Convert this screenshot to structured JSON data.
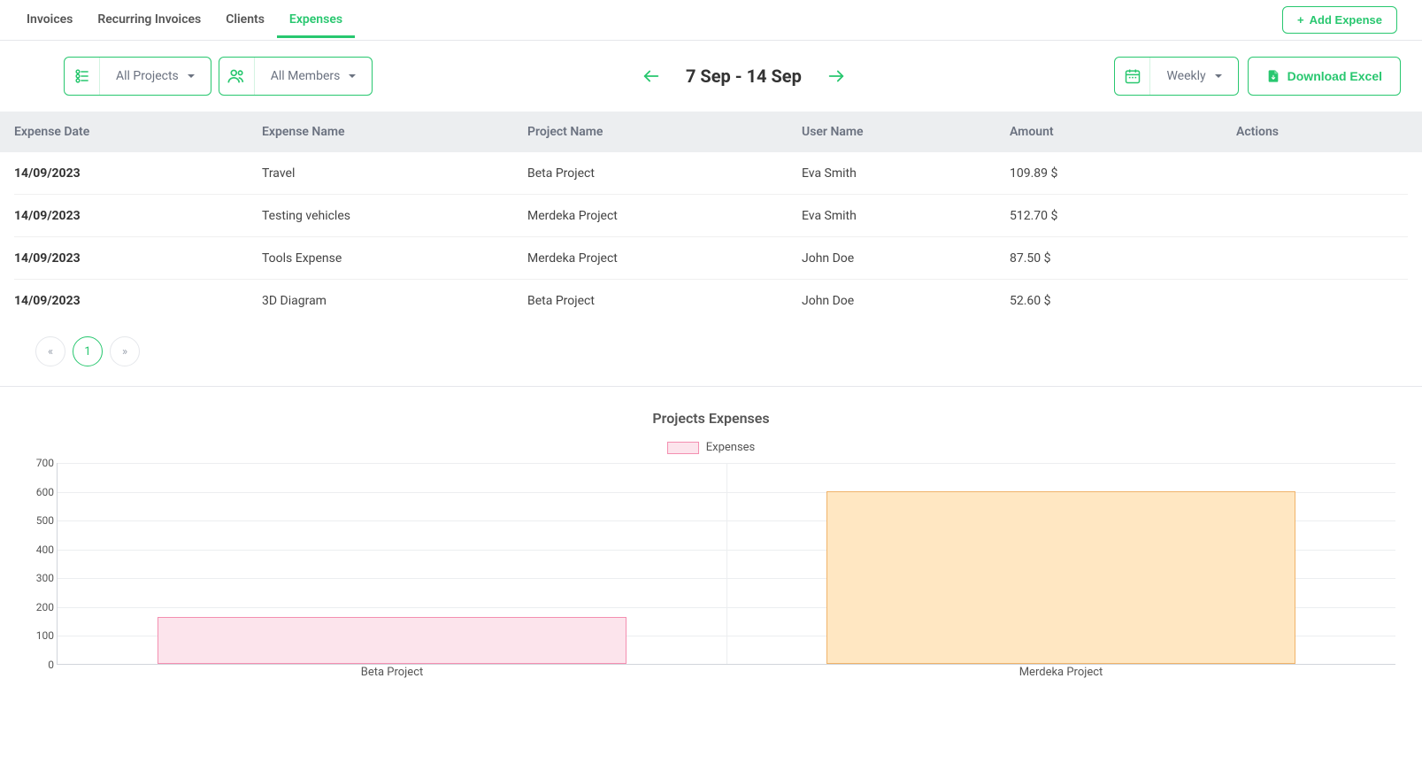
{
  "tabs": {
    "invoices": "Invoices",
    "recurring": "Recurring Invoices",
    "clients": "Clients",
    "expenses": "Expenses"
  },
  "buttons": {
    "add_expense": "Add Expense",
    "download_excel": "Download Excel"
  },
  "filters": {
    "projects": "All Projects",
    "members": "All Members",
    "frequency": "Weekly"
  },
  "date_range": "7 Sep - 14 Sep",
  "table": {
    "headers": {
      "date": "Expense Date",
      "name": "Expense Name",
      "project": "Project Name",
      "user": "User Name",
      "amount": "Amount",
      "actions": "Actions"
    },
    "rows": [
      {
        "date": "14/09/2023",
        "name": "Travel",
        "project": "Beta Project",
        "user": "Eva Smith",
        "amount": "109.89 $"
      },
      {
        "date": "14/09/2023",
        "name": "Testing vehicles",
        "project": "Merdeka Project",
        "user": "Eva Smith",
        "amount": "512.70 $"
      },
      {
        "date": "14/09/2023",
        "name": "Tools Expense",
        "project": "Merdeka Project",
        "user": "John Doe",
        "amount": "87.50 $"
      },
      {
        "date": "14/09/2023",
        "name": "3D Diagram",
        "project": "Beta Project",
        "user": "John Doe",
        "amount": "52.60 $"
      }
    ]
  },
  "pagination": {
    "prev": "«",
    "page1": "1",
    "next": "»"
  },
  "chart_data": {
    "type": "bar",
    "title": "Projects Expenses",
    "legend": "Expenses",
    "categories": [
      "Beta Project",
      "Merdeka Project"
    ],
    "values": [
      162.49,
      600.2
    ],
    "colors_fill": [
      "#fce4ec",
      "#ffe7c2"
    ],
    "colors_border": [
      "#f48fb1",
      "#f0b36a"
    ],
    "ylim": [
      0,
      700
    ],
    "yticks": [
      0,
      100,
      200,
      300,
      400,
      500,
      600,
      700
    ],
    "xlabel": "",
    "ylabel": ""
  }
}
